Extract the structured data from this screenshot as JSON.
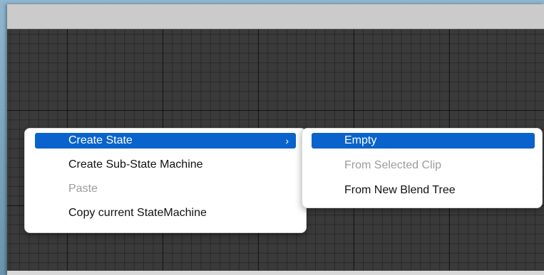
{
  "context_menu": {
    "items": [
      {
        "label": "Create State",
        "has_submenu": true,
        "highlighted": true
      },
      {
        "label": "Create Sub-State Machine"
      },
      {
        "label": "Paste",
        "disabled": true
      },
      {
        "label": "Copy current StateMachine"
      }
    ],
    "submenu_arrow": "›"
  },
  "submenu": {
    "items": [
      {
        "label": "Empty",
        "highlighted": true
      },
      {
        "label": "From Selected Clip",
        "disabled": true
      },
      {
        "label": "From New Blend Tree"
      }
    ]
  },
  "colors": {
    "highlight": "#0a63cc",
    "disabled_text": "#9c9c9c",
    "canvas": "#3a3a3a"
  }
}
